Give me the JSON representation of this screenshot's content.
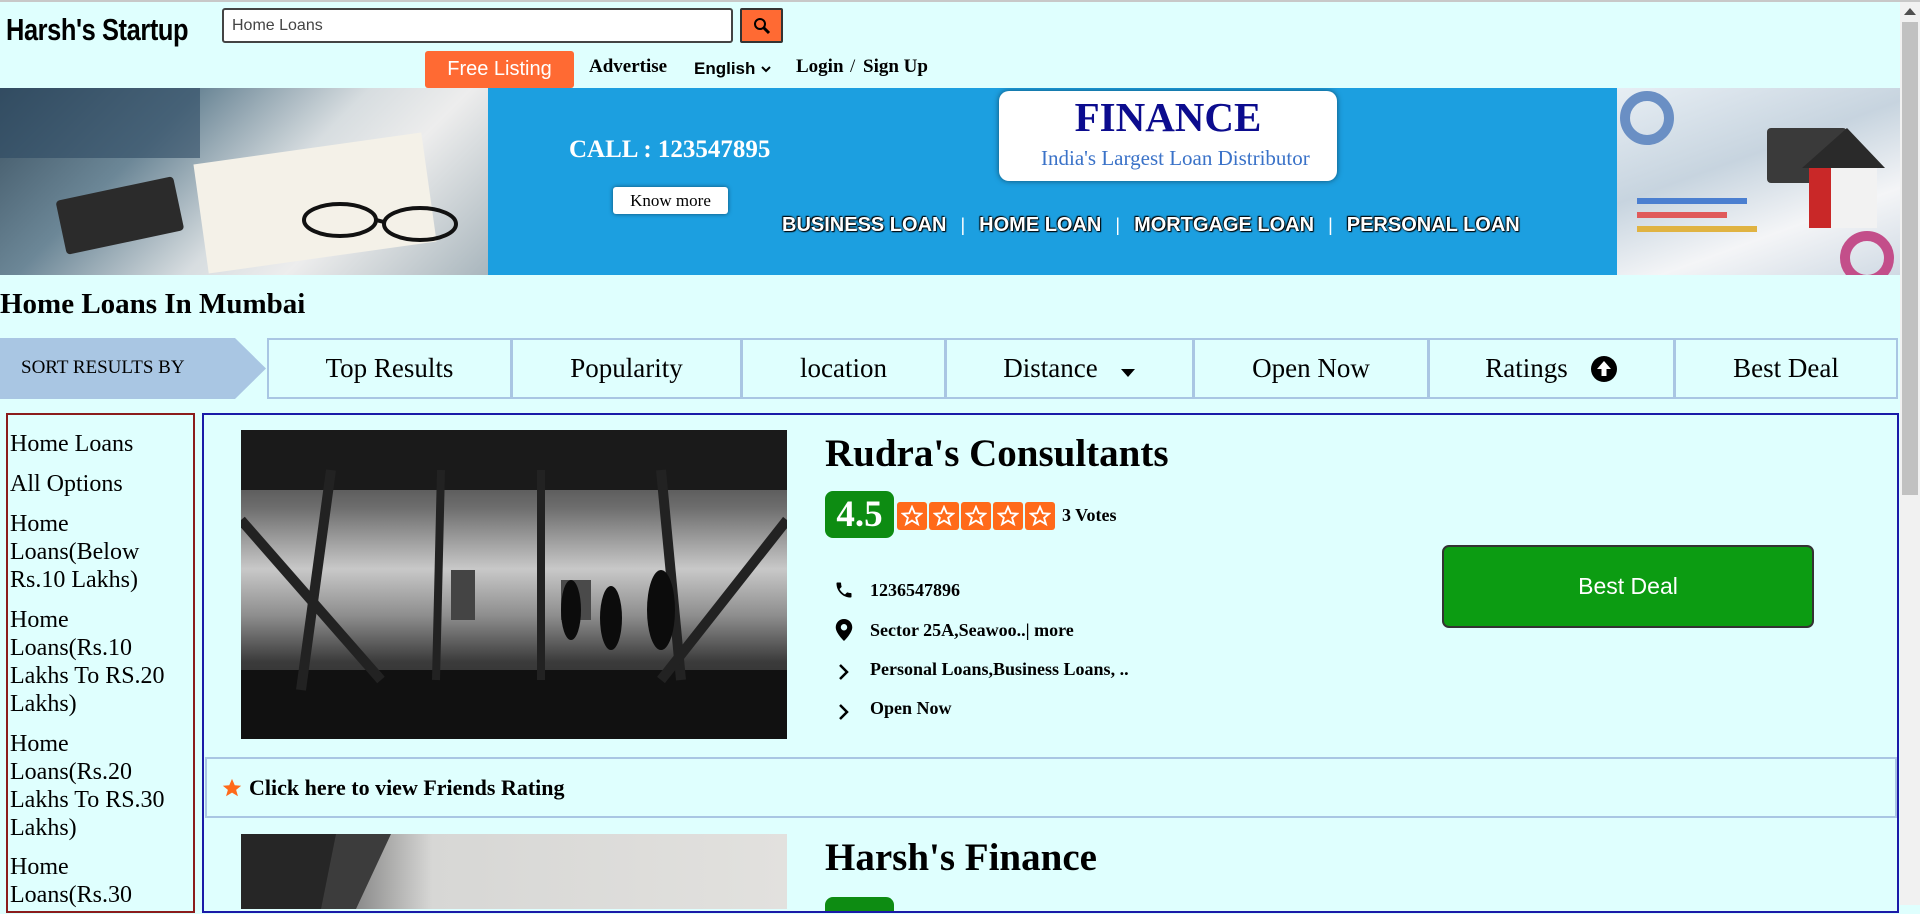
{
  "header": {
    "logo": "Harsh's Startup",
    "search_value": "Home Loans",
    "search_icon": "search-icon",
    "free_listing": "Free Listing",
    "advertise": "Advertise",
    "language": "English",
    "login": "Login",
    "slash": "/",
    "signup": "Sign Up"
  },
  "banner": {
    "call": "CALL : 123547895",
    "know_more": "Know more",
    "finance_title": "FINANCE",
    "finance_subtitle": "India's Largest Loan Distributor",
    "loan_types": [
      "BUSINESS LOAN",
      "HOME LOAN",
      "MORTGAGE LOAN",
      "PERSONAL LOAN"
    ],
    "separator": "|"
  },
  "page": {
    "heading": "Home Loans In Mumbai"
  },
  "sort": {
    "label": "SORT RESULTS BY",
    "options": [
      "Top Results",
      "Popularity",
      "location",
      "Distance",
      "Open Now",
      "Ratings",
      "Best Deal"
    ]
  },
  "sidebar": {
    "items": [
      "Home Loans",
      "All Options",
      "Home Loans(Below Rs.10 Lakhs)",
      "Home Loans(Rs.10 Lakhs To RS.20 Lakhs)",
      "Home Loans(Rs.20 Lakhs To RS.30 Lakhs)",
      "Home Loans(Rs.30"
    ]
  },
  "listings": [
    {
      "name": "Rudra's Consultants",
      "rating": "4.5",
      "stars": 5,
      "votes": "3 Votes",
      "phone": "1236547896",
      "address": "Sector 25A,Seawoo..| more",
      "services": "Personal Loans,Business Loans, ..",
      "status": "Open Now",
      "best_deal": "Best Deal",
      "friends_rating": "Click here to view Friends Rating"
    },
    {
      "name": "Harsh's Finance"
    }
  ],
  "colors": {
    "background": "#dffffe",
    "accent_orange": "#ff6a33",
    "green": "#0c9c12",
    "banner_blue": "#1c9fe0"
  }
}
